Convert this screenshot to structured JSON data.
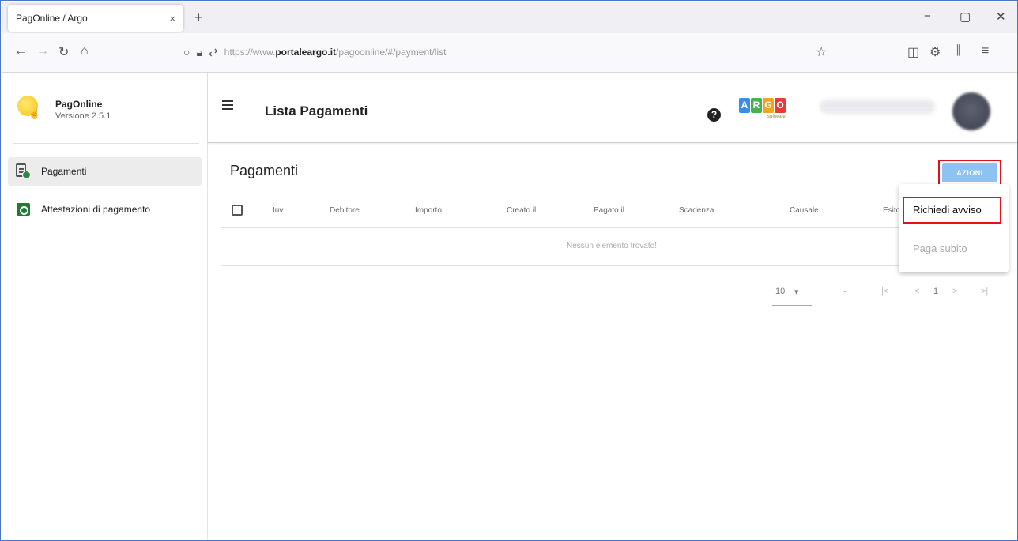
{
  "browser": {
    "tab_title": "PagOnline / Argo",
    "tab_close": "×",
    "new_tab": "+",
    "window_controls": [
      "−",
      "▢",
      "✕"
    ],
    "nav_icons": [
      "back-icon",
      "forward-icon",
      "reload-icon",
      "home-icon"
    ],
    "nav_glyphs": [
      "←",
      "→",
      "↻",
      "⌂"
    ],
    "url_prefix": "https://www.",
    "url_host": "portaleargo.it",
    "url_path": "/pagoonline/#/payment/list",
    "url_star": "☆",
    "toolbar_glyphs": [
      "◫",
      "⚙",
      "⫼",
      "≡"
    ]
  },
  "sidebar": {
    "app_name": "PagOnline",
    "version": "Versione 2.5.1",
    "items": [
      {
        "label": "Pagamenti",
        "icon": "payments-doc-icon",
        "active": true
      },
      {
        "label": "Attestazioni di pagamento",
        "icon": "receipt-cash-icon",
        "active": false
      }
    ]
  },
  "header": {
    "title": "Lista Pagamenti",
    "help": "?",
    "logo_letters": [
      {
        "char": "A",
        "color": "#3a8ee6"
      },
      {
        "char": "R",
        "color": "#46b24e"
      },
      {
        "char": "G",
        "color": "#f2a61d"
      },
      {
        "char": "O",
        "color": "#e53b3b"
      }
    ],
    "logo_sub": "software"
  },
  "main": {
    "section_title": "Pagamenti",
    "actions_button": "AZIONI",
    "columns": [
      "Iuv",
      "Debitore",
      "Importo",
      "Creato il",
      "Pagato il",
      "Scadenza",
      "Causale",
      "Esito"
    ],
    "empty_message": "Nessun elemento trovato!",
    "pagination": {
      "page_size": "10",
      "page_size_arrow": "▾",
      "range": "-",
      "first": "|<",
      "prev": "<",
      "current": "1",
      "next": ">",
      "last": ">|"
    }
  },
  "menu": {
    "items": [
      {
        "label": "Richiedi avviso",
        "enabled": true
      },
      {
        "label": "Paga subito",
        "enabled": false
      }
    ]
  }
}
